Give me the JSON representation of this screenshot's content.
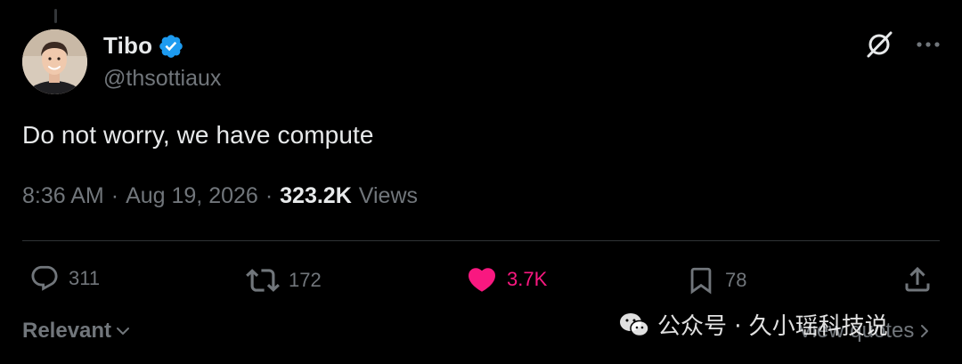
{
  "author": {
    "display_name": "Tibo",
    "handle": "@thsottiaux",
    "verified": true,
    "avatar_icon": "avatar-photo"
  },
  "tweet": {
    "text": "Do not worry, we have compute",
    "time": "8:36 AM",
    "date": "Aug 19, 2026",
    "separator": "·",
    "views_count": "323.2K",
    "views_label": "Views"
  },
  "actions": {
    "reply": {
      "count": "311",
      "icon": "reply-icon"
    },
    "repost": {
      "count": "172",
      "icon": "repost-icon"
    },
    "like": {
      "count": "3.7K",
      "icon": "heart-icon",
      "active": true
    },
    "bookmark": {
      "count": "78",
      "icon": "bookmark-icon"
    },
    "share": {
      "icon": "share-icon"
    }
  },
  "footer": {
    "sort_label": "Relevant",
    "view_quotes_label": "View quotes"
  },
  "watermark": {
    "text": "公众号 · 久小瑶科技说",
    "icon": "wechat-icon"
  },
  "colors": {
    "background": "#000000",
    "primary_text": "#e7e9ea",
    "secondary_text": "#71767b",
    "verified_blue": "#1d9bf0",
    "like_pink": "#f91880",
    "divider": "#2f3336"
  }
}
